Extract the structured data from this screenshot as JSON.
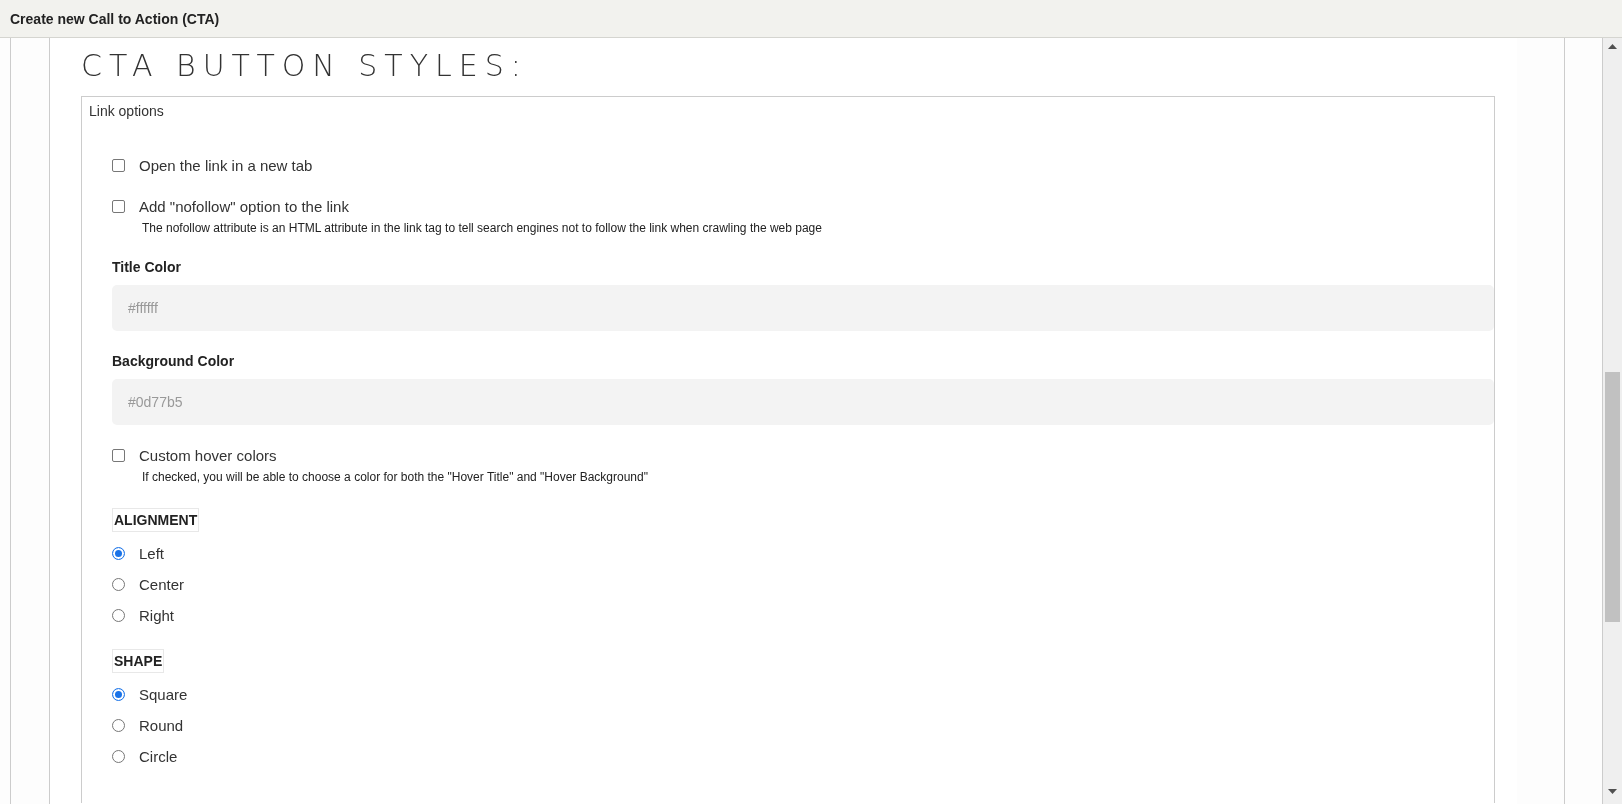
{
  "window": {
    "title": "Create new Call to Action (CTA)"
  },
  "heading": "CTA BUTTON STYLES:",
  "section": {
    "legend": "Link options"
  },
  "options": [
    {
      "label": "Open the link in a new tab",
      "checked": false
    },
    {
      "label": "Add \"nofollow\" option to the link",
      "checked": false,
      "description": "The nofollow attribute is an HTML attribute in the link tag to tell search engines not to follow the link when crawling the web page"
    }
  ],
  "fields": [
    {
      "label": "Title Color",
      "placeholder": "#ffffff"
    },
    {
      "label": "Background Color",
      "placeholder": "#0d77b5"
    }
  ],
  "hover_option": {
    "label": "Custom hover colors",
    "checked": false,
    "description": "If checked, you will be able to choose a color for both the \"Hover Title\" and \"Hover Background\""
  },
  "radio_groups": [
    {
      "title": "ALIGNMENT",
      "options": [
        {
          "label": "Left",
          "selected": true
        },
        {
          "label": "Center",
          "selected": false
        },
        {
          "label": "Right",
          "selected": false
        }
      ]
    },
    {
      "title": "SHAPE",
      "options": [
        {
          "label": "Square",
          "selected": true
        },
        {
          "label": "Round",
          "selected": false
        },
        {
          "label": "Circle",
          "selected": false
        }
      ]
    }
  ]
}
